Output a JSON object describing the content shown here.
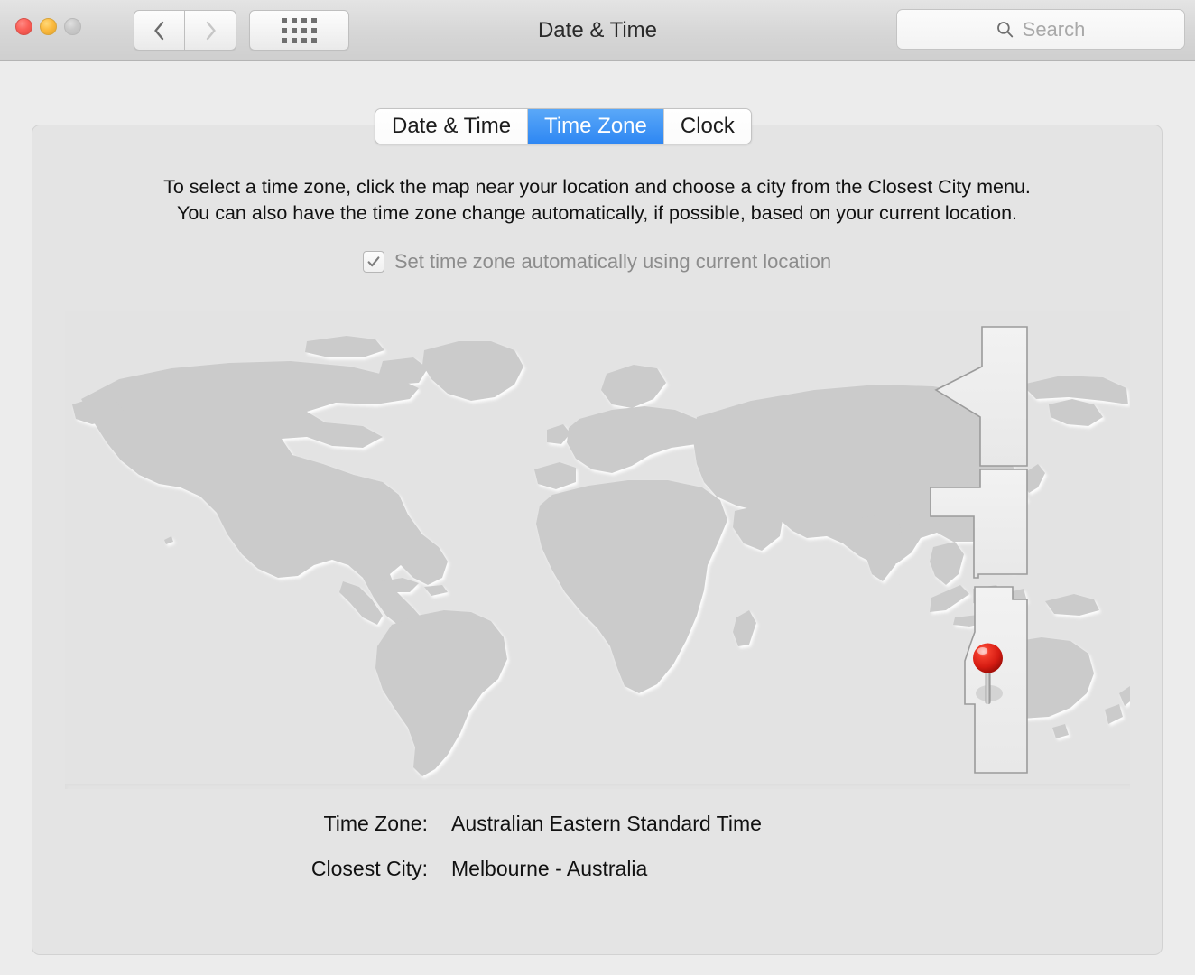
{
  "window": {
    "title": "Date & Time",
    "traffic_lights": [
      "close",
      "minimize",
      "zoom"
    ],
    "nav": {
      "back_icon": "chevron-left-icon",
      "forward_icon": "chevron-right-icon"
    },
    "show_all_icon": "grid-icon"
  },
  "search": {
    "placeholder": "Search",
    "icon": "search-icon",
    "value": ""
  },
  "tabs": [
    {
      "label": "Date & Time",
      "selected": false
    },
    {
      "label": "Time Zone",
      "selected": true
    },
    {
      "label": "Clock",
      "selected": false
    }
  ],
  "pane": {
    "instructions_line1": "To select a time zone, click the map near your location and choose a city from the Closest City menu.",
    "instructions_line2": "You can also have the time zone change automatically, if possible, based on your current location.",
    "auto_timezone": {
      "label": "Set time zone automatically using current location",
      "checked": true,
      "enabled": false,
      "check_icon": "checkmark-icon"
    },
    "map": {
      "pin_icon": "map-pin-icon",
      "pin_label": "Melbourne",
      "highlighted_zone": "Australian Eastern Standard Time"
    },
    "fields": [
      {
        "label": "Time Zone:",
        "value": "Australian Eastern Standard Time"
      },
      {
        "label": "Closest City:",
        "value": "Melbourne - Australia"
      }
    ]
  },
  "colors": {
    "accent": "#2e87f3",
    "pin": "#e02020",
    "land": "#cdcdcd",
    "ocean": "#e3e3e3",
    "zone_highlight": "#ededed"
  }
}
